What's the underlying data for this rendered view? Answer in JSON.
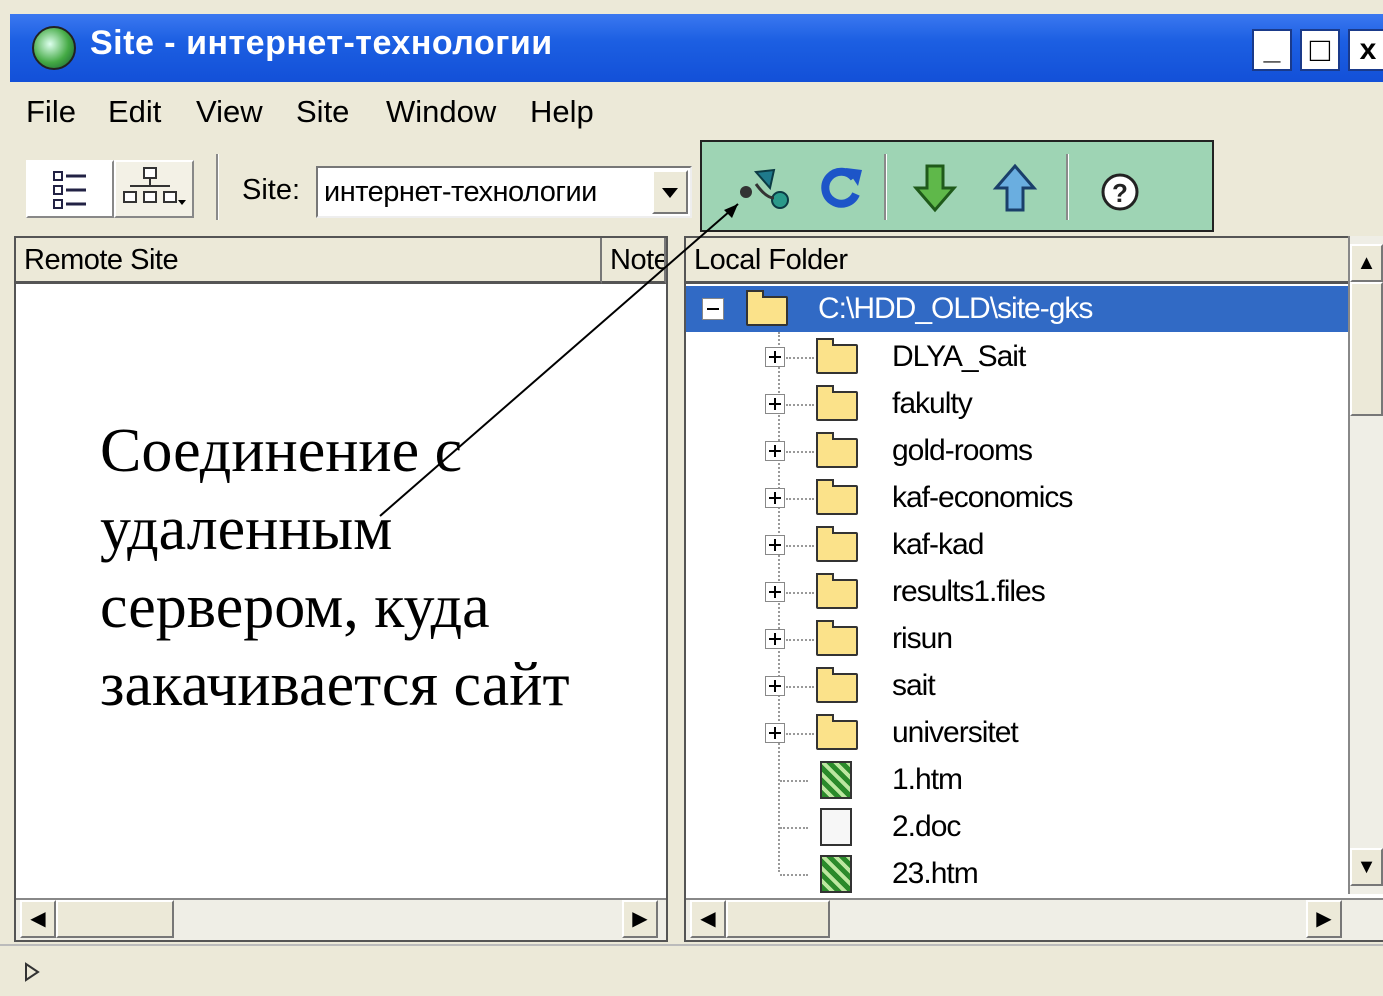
{
  "window": {
    "title": "Site - интернет-технологии",
    "buttons": [
      "_",
      "□",
      "x"
    ]
  },
  "menu": [
    "File",
    "Edit",
    "View",
    "Site",
    "Window",
    "Help"
  ],
  "toolbar": {
    "site_label": "Site:",
    "site_value": "интернет-технологии",
    "icons": [
      "details-view-icon",
      "site-map-icon",
      "connect-icon",
      "refresh-icon",
      "get-icon",
      "put-icon",
      "help-icon"
    ],
    "highlight_color": "#9ed4b4"
  },
  "remote_panel": {
    "col_remote": "Remote Site",
    "col_notes": "Note"
  },
  "local_panel": {
    "col_local": "Local Folder",
    "root": "C:\\HDD_OLD\\site-gks",
    "items": [
      {
        "name": "DLYA_Sait",
        "type": "folder"
      },
      {
        "name": "fakulty",
        "type": "folder"
      },
      {
        "name": "gold-rooms",
        "type": "folder"
      },
      {
        "name": "kaf-economics",
        "type": "folder"
      },
      {
        "name": "kaf-kad",
        "type": "folder"
      },
      {
        "name": "results1.files",
        "type": "folder"
      },
      {
        "name": "risun",
        "type": "folder"
      },
      {
        "name": "sait",
        "type": "folder"
      },
      {
        "name": "universitet",
        "type": "folder"
      },
      {
        "name": "1.htm",
        "type": "htm"
      },
      {
        "name": "2.doc",
        "type": "doc"
      },
      {
        "name": "23.htm",
        "type": "htm"
      }
    ]
  },
  "annotation": {
    "lines": [
      "Соединение с",
      "удаленным",
      "сервером, куда",
      "закачивается сайт"
    ]
  },
  "colors": {
    "titlebar": "#1c5fe2",
    "selection": "#316ac5",
    "chrome": "#ECE9D8"
  }
}
